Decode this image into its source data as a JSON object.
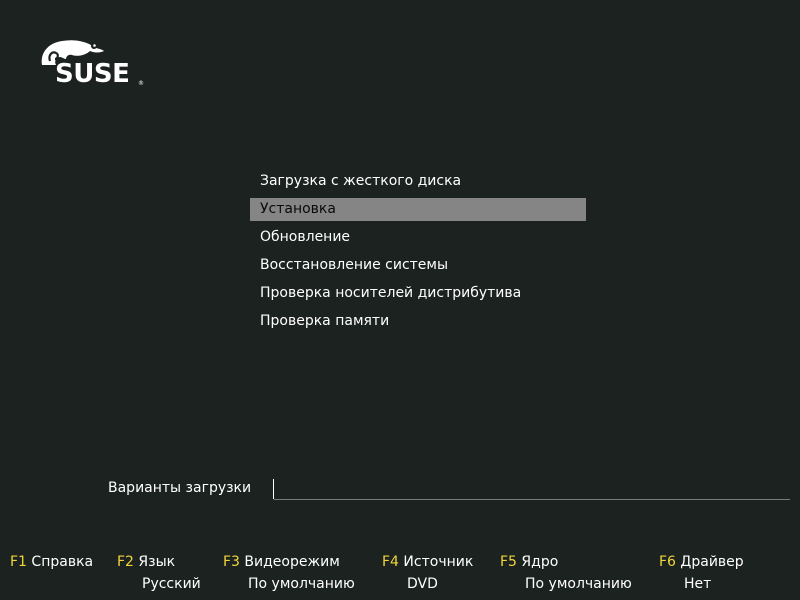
{
  "logo": {
    "text": "SUSE",
    "reg": "®"
  },
  "menu": {
    "items": [
      {
        "label": "Загрузка с жесткого диска",
        "selected": false
      },
      {
        "label": "Установка",
        "selected": true
      },
      {
        "label": "Обновление",
        "selected": false
      },
      {
        "label": "Восстановление системы",
        "selected": false
      },
      {
        "label": "Проверка носителей дистрибутива",
        "selected": false
      },
      {
        "label": "Проверка памяти",
        "selected": false
      }
    ]
  },
  "boot_options": {
    "label": "Варианты загрузки",
    "value": ""
  },
  "function_keys": [
    {
      "key": "F1",
      "name": "Справка",
      "value": ""
    },
    {
      "key": "F2",
      "name": "Язык",
      "value": "Русский"
    },
    {
      "key": "F3",
      "name": "Видеорежим",
      "value": "По умолчанию"
    },
    {
      "key": "F4",
      "name": "Источник",
      "value": "DVD"
    },
    {
      "key": "F5",
      "name": "Ядро",
      "value": "По умолчанию"
    },
    {
      "key": "F6",
      "name": "Драйвер",
      "value": "Нет"
    }
  ],
  "colors": {
    "background": "#1b2220",
    "selection": "#858585",
    "fkey_accent": "#f2d43a"
  }
}
